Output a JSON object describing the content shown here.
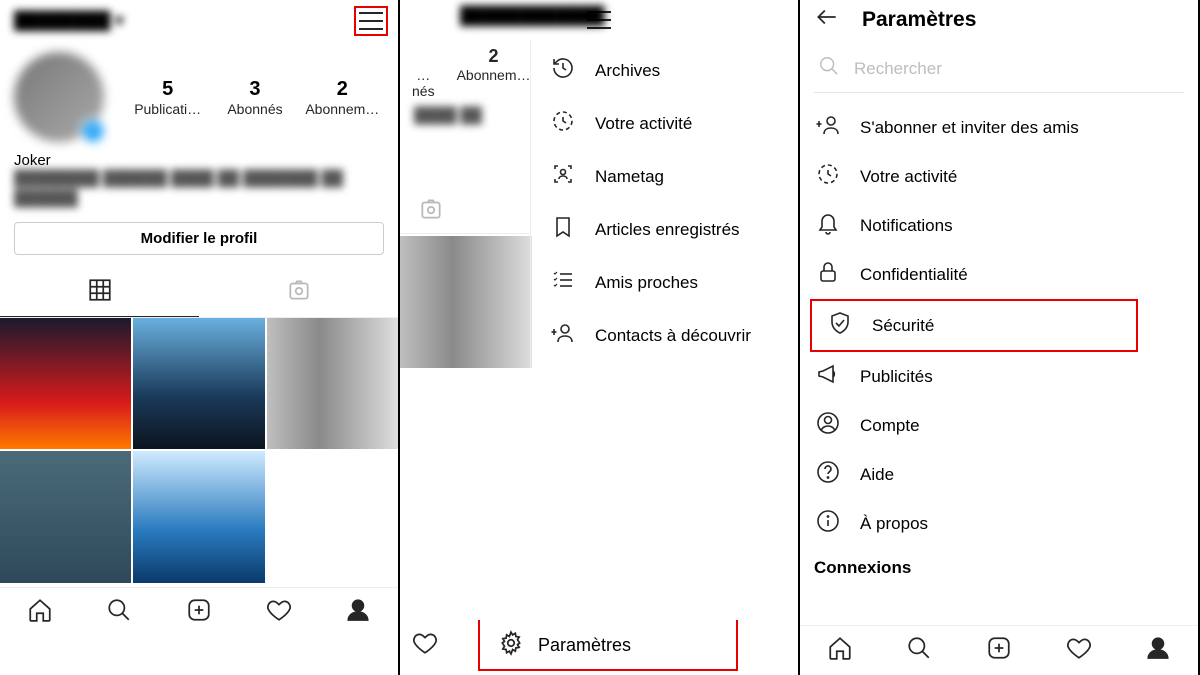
{
  "panel1": {
    "username": "████████ ▾",
    "stats": [
      {
        "n": "5",
        "l": "Publicati…"
      },
      {
        "n": "3",
        "l": "Abonnés"
      },
      {
        "n": "2",
        "l": "Abonnem…"
      }
    ],
    "display_name": "Joker",
    "bio_blur": "████████ ██████ ████ ██ ███████ ██ ██████",
    "edit_label": "Modifier le profil"
  },
  "panel2": {
    "username_blur": "████████████",
    "partial_stats": [
      {
        "n": "",
        "l": "…nés"
      },
      {
        "n": "2",
        "l": "Abonnem…"
      }
    ],
    "bio_blur": "████ ██",
    "menu": [
      {
        "icon": "archive",
        "label": "Archives"
      },
      {
        "icon": "activity",
        "label": "Votre activité"
      },
      {
        "icon": "nametag",
        "label": "Nametag"
      },
      {
        "icon": "bookmark",
        "label": "Articles enregistrés"
      },
      {
        "icon": "closefriends",
        "label": "Amis proches"
      },
      {
        "icon": "discover",
        "label": "Contacts à découvrir"
      }
    ],
    "settings_label": "Paramètres"
  },
  "panel3": {
    "title": "Paramètres",
    "search_placeholder": "Rechercher",
    "items": [
      {
        "icon": "adduser",
        "label": "S'abonner et inviter des amis"
      },
      {
        "icon": "activity",
        "label": "Votre activité"
      },
      {
        "icon": "bell",
        "label": "Notifications"
      },
      {
        "icon": "lock",
        "label": "Confidentialité"
      },
      {
        "icon": "shield",
        "label": "Sécurité",
        "hl": true
      },
      {
        "icon": "megaphone",
        "label": "Publicités"
      },
      {
        "icon": "account",
        "label": "Compte"
      },
      {
        "icon": "help",
        "label": "Aide"
      },
      {
        "icon": "info",
        "label": "À propos"
      }
    ],
    "section": "Connexions"
  }
}
